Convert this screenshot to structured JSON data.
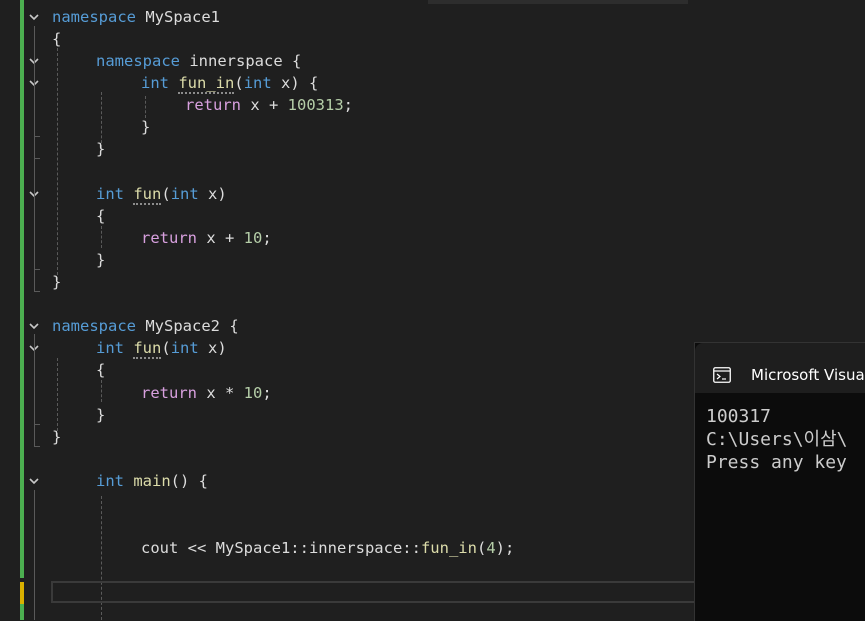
{
  "editor": {
    "lines": {
      "l1": {
        "kw": "namespace",
        "name": "MySpace1"
      },
      "l2": {
        "brace": "{"
      },
      "l3": {
        "kw": "namespace",
        "name": "innerspace",
        "brace": "{"
      },
      "l4": {
        "type": "int",
        "fn": "fun_in",
        "open": "(",
        "ptype": "int",
        "param": "x",
        "close": ") {"
      },
      "l5": {
        "kw": "return",
        "expr": "x + ",
        "num": "100313",
        "end": ";"
      },
      "l6": {
        "brace": "}"
      },
      "l7": {
        "brace": "}"
      },
      "l8": {
        "type": "int",
        "fn": "fun",
        "open": "(",
        "ptype": "int",
        "param": "x",
        "close": ")"
      },
      "l9": {
        "brace": "{"
      },
      "l10": {
        "kw": "return",
        "expr": "x + ",
        "num": "10",
        "end": ";"
      },
      "l11": {
        "brace": "}"
      },
      "l12": {
        "brace": "}"
      },
      "l13": {
        "kw": "namespace",
        "name": "MySpace2",
        "brace": "{"
      },
      "l14": {
        "type": "int",
        "fn": "fun",
        "open": "(",
        "ptype": "int",
        "param": "x",
        "close": ")"
      },
      "l15": {
        "brace": "{"
      },
      "l16": {
        "kw": "return",
        "expr": "x * ",
        "num": "10",
        "end": ";"
      },
      "l17": {
        "brace": "}"
      },
      "l18": {
        "brace": "}"
      },
      "l19": {
        "type": "int",
        "fn": "main",
        "close": "() {"
      },
      "l20": {
        "pre": "cout << MySpace1::innerspace::",
        "fn": "fun_in",
        "open": "(",
        "num": "4",
        "end": ");"
      }
    }
  },
  "console": {
    "title": "Microsoft Visual S",
    "output": [
      "100317",
      "C:\\Users\\이삼\\",
      "Press any key"
    ]
  }
}
